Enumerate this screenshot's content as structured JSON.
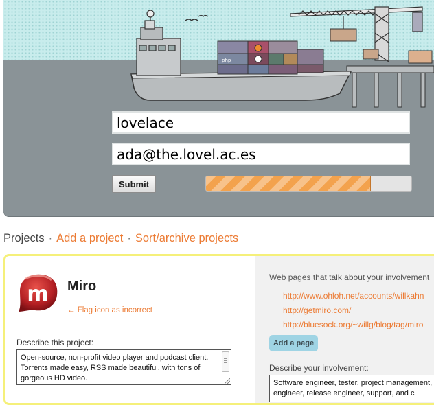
{
  "signup": {
    "username_value": "lovelace",
    "email_value": "ada@the.lovel.ac.es",
    "submit_label": "Submit",
    "progress_fraction": 0.8
  },
  "hero": {
    "container_labels": [
      "php"
    ]
  },
  "nav": {
    "projects_label": "Projects",
    "separator": "·",
    "add_project_label": "Add a project",
    "sort_archive_label": "Sort/archive projects"
  },
  "project": {
    "name": "Miro",
    "logo_letter": "m",
    "flag_label": "← Flag icon as incorrect",
    "describe_label": "Describe this project:",
    "description": "Open-source, non-profit video player and podcast client.  Torrents made easy, RSS made beautiful, with tons of gorgeous HD video.",
    "webpages_label": "Web pages that talk about your involvement",
    "urls": [
      "http://www.ohloh.net/accounts/willkahn",
      "http://getmiro.com/",
      "http://bluesock.org/~willg/blog/tag/miro"
    ],
    "add_page_label": "Add a page",
    "involvement_label": "Describe your involvement:",
    "involvement_lines": [
      "Software engineer, tester, project management,",
      "engineer, release engineer, support, and c"
    ]
  },
  "colors": {
    "accent_orange": "#ec7b34",
    "panel_border": "#f5f07a",
    "hero_gray": "#8a9397",
    "sky": "#c8ecec",
    "add_page_blue": "#9fd4e4"
  }
}
